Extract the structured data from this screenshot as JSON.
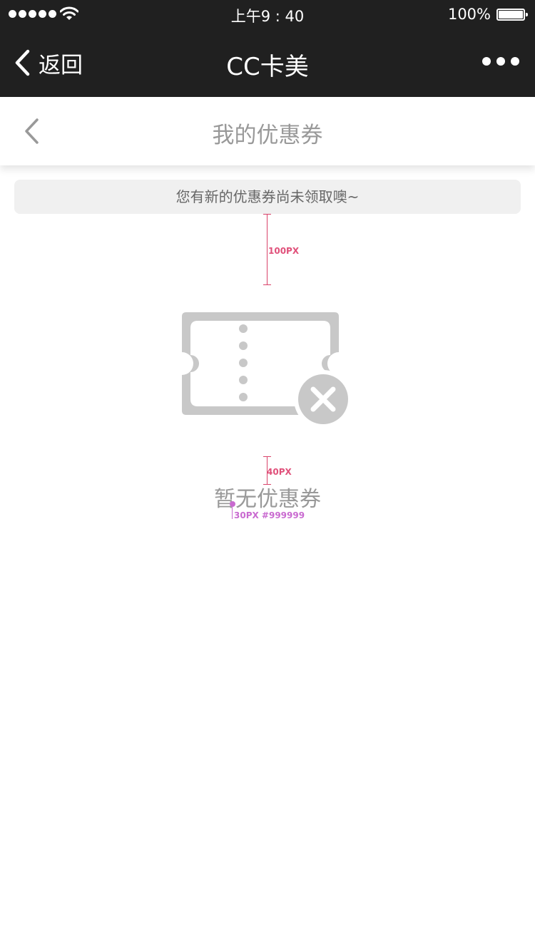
{
  "status_bar": {
    "time": "上午9 : 40",
    "battery_percent": "100%"
  },
  "nav_bar": {
    "back_label": "返回",
    "title": "CC卡美",
    "more_icon": "more-icon"
  },
  "page_header": {
    "title": "我的优惠券",
    "back_icon": "chevron-left-icon"
  },
  "notice": {
    "text": "您有新的优惠券尚未领取噢~"
  },
  "empty_state": {
    "icon": "coupon-unavailable-icon",
    "text": "暂无优惠券"
  },
  "annotations": {
    "spacing_top": "100PX",
    "spacing_text": "40PX",
    "text_spec": "30PX #999999"
  },
  "colors": {
    "bar_background": "#202020",
    "title_gray": "#999999",
    "icon_gray": "#c8c8c8",
    "notice_background": "#f0f0f0",
    "annotation_pink": "#e0507a",
    "annotation_purple": "#c96ad0"
  }
}
